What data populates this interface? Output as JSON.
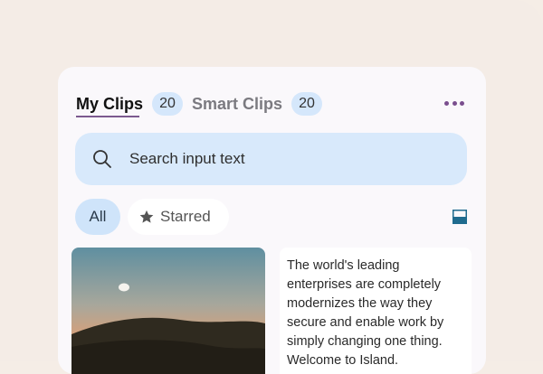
{
  "tabs": [
    {
      "label": "My Clips",
      "count": "20"
    },
    {
      "label": "Smart Clips",
      "count": "20"
    }
  ],
  "search": {
    "placeholder": "Search input text"
  },
  "filters": {
    "all": "All",
    "starred": "Starred"
  },
  "clips": {
    "text_card": "The world's leading enterprises are completely modernizes the way they secure and enable work by simply changing one thing. Welcome to Island."
  },
  "colors": {
    "accent": "#7a4e8e",
    "chip": "#d5e7fb",
    "search_bg": "#d8e9fb"
  }
}
